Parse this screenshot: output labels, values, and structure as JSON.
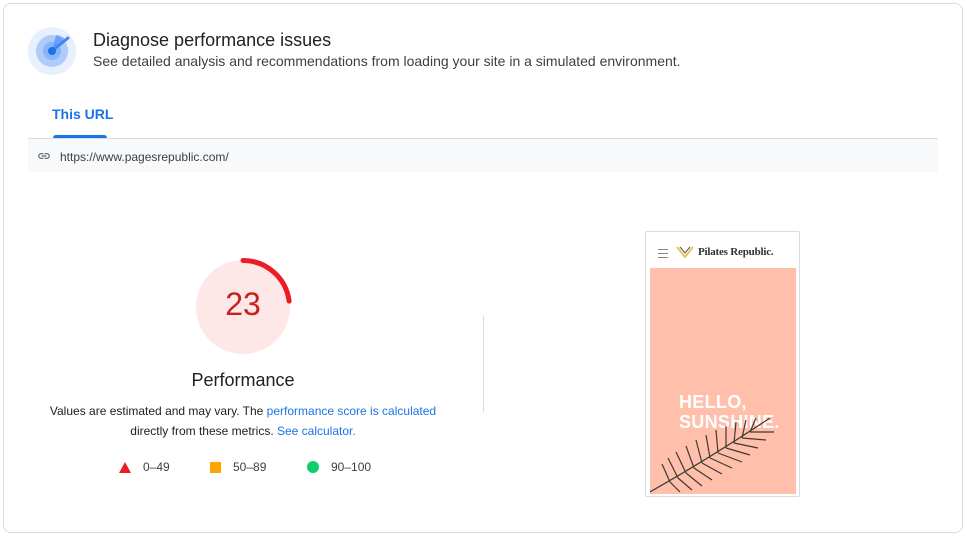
{
  "header": {
    "title": "Diagnose performance issues",
    "subtitle": "See detailed analysis and recommendations from loading your site in a simulated environment."
  },
  "tabs": [
    {
      "label": "This URL",
      "active": true
    }
  ],
  "url_bar": {
    "url": "https://www.pagesrepublic.com/"
  },
  "performance": {
    "score": "23",
    "score_fraction": 0.23,
    "label": "Performance",
    "description_1": "Values are estimated and may vary. The ",
    "description_link1": "performance score is calculated",
    "description_2": "directly from these metrics. ",
    "description_link2": "See calculator.",
    "score_color": "#c5221f"
  },
  "legend": [
    {
      "shape": "triangle",
      "range": "0–49",
      "color": "#eb1c24"
    },
    {
      "shape": "square",
      "range": "50–89",
      "color": "#ffa400"
    },
    {
      "shape": "circle",
      "range": "90–100",
      "color": "#0cce6b"
    }
  ],
  "screenshot": {
    "brand": "Pilates Republic.",
    "hero_line1": "HELLO,",
    "hero_line2": "SUNSHINE.",
    "hero_color": "#ffbfaa"
  }
}
